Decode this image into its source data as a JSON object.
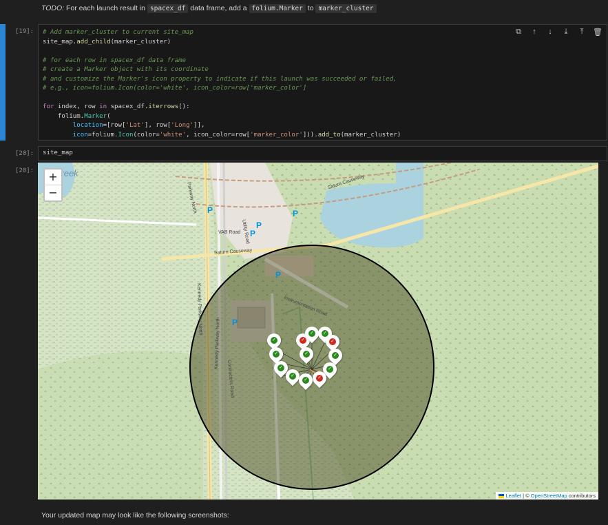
{
  "todo": {
    "prefix": "TODO:",
    "text1": " For each launch result in ",
    "code1": "spacex_df",
    "text2": " data frame, add a ",
    "code2": "folium.Marker",
    "text3": " to ",
    "code3": "marker_cluster"
  },
  "cell19": {
    "prompt": "[19]:",
    "lines": {
      "l1": "# Add marker_cluster to current site_map",
      "l2a": "site_map.",
      "l2b": "add_child",
      "l2c": "(marker_cluster)",
      "l4": "# for each row in spacex_df data frame",
      "l5": "# create a Marker object with its coordinate",
      "l6": "# and customize the Marker's icon property to indicate if this launch was succeeded or failed,",
      "l7": "# e.g., icon=folium.Icon(color='white', icon_color=row['marker_color']",
      "l9a": "for",
      "l9b": " index, row ",
      "l9c": "in",
      "l9d": " spacex_df.",
      "l9e": "iterrows",
      "l9f": "():",
      "l10a": "    folium.",
      "l10b": "Marker",
      "l10c": "(",
      "l11a": "        location",
      "l11b": "=[row[",
      "l11c": "'Lat'",
      "l11d": "], row[",
      "l11e": "'Long'",
      "l11f": "]],",
      "l12a": "        icon",
      "l12b": "=folium.",
      "l12c": "Icon",
      "l12d": "(color=",
      "l12e": "'white'",
      "l12f": ", icon_color=row[",
      "l12g": "'marker_color'",
      "l12h": "])).",
      "l12i": "add_to",
      "l12j": "(marker_cluster)"
    }
  },
  "cell20": {
    "prompt": "[20]:",
    "code": "site_map",
    "output_prompt": "[20]:"
  },
  "toolbar": {
    "icons": [
      "split-cell-icon",
      "move-up-icon",
      "move-down-icon",
      "insert-below-icon",
      "insert-above-icon",
      "delete-icon"
    ],
    "glyphs": [
      "⧉",
      "↑",
      "↓",
      "⤓",
      "⤒",
      "🗑"
    ]
  },
  "map": {
    "zoom_in": "+",
    "zoom_out": "−",
    "labels": {
      "creek": "Creek",
      "saturn1": "Saturn Causeway",
      "saturn2": "Saturn Causeway",
      "vab": "VAB Road",
      "utility": "Utility Road",
      "instr": "Instrumentation Road",
      "kennedy1": "Kennedy Parkway North",
      "kennedy2": "Kennedy Parkway North",
      "kennedy3": "Parkway North",
      "contractors": "Contractors Road"
    },
    "parking": "P",
    "marker_glyph": "✓",
    "attribution": {
      "leaflet": "Leaflet",
      "sep": " | © ",
      "osm": "OpenStreetMap",
      "tail": " contributors"
    },
    "colors": {
      "success": "#2b8a1e",
      "failure": "#d12a1f",
      "circle": "#000000"
    }
  },
  "footer_text": "Your updated map may look like the following screenshots:"
}
